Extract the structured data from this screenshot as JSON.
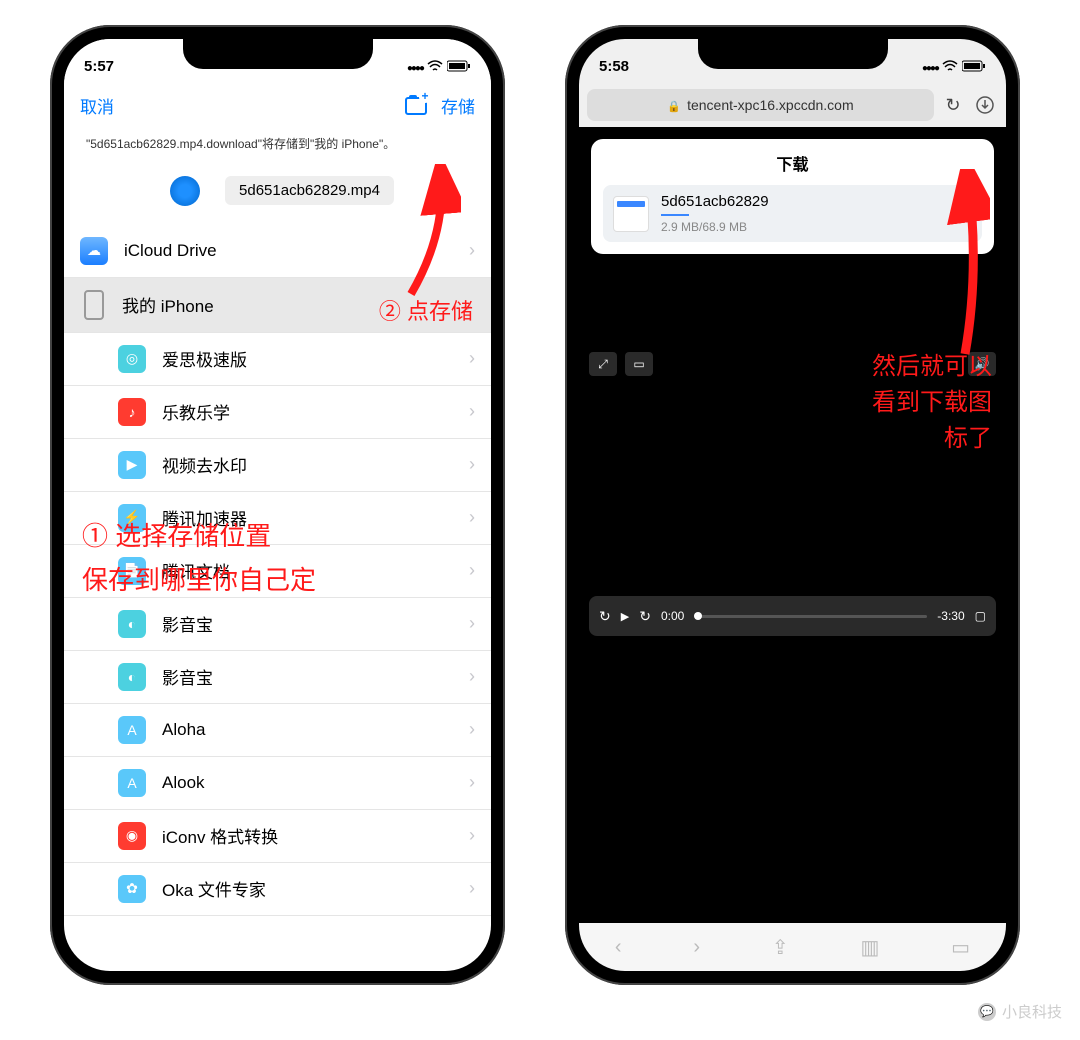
{
  "left": {
    "time": "5:57",
    "nav": {
      "cancel": "取消",
      "save": "存储"
    },
    "subtext": "\"5d651acb62829.mp4.download\"将存储到\"我的 iPhone\"。",
    "filename": "5d651acb62829.mp4",
    "locations": {
      "icloud": "iCloud Drive",
      "myiphone": "我的 iPhone"
    },
    "folders": [
      "爱思极速版",
      "乐教乐学",
      "视频去水印",
      "腾讯加速器",
      "腾讯文档",
      "影音宝",
      "影音宝",
      "Aloha",
      "Alook",
      "iConv 格式转换",
      "Oka 文件专家"
    ],
    "anno_step2": "② 点存储",
    "anno_step1_line1": "① 选择存储位置",
    "anno_step1_line2": "保存到哪里你自己定"
  },
  "right": {
    "time": "5:58",
    "url": "tencent-xpc16.xpccdn.com",
    "download": {
      "title": "下载",
      "name": "5d651acb62829",
      "size": "2.9 MB/68.9 MB"
    },
    "video": {
      "current": "0:00",
      "remaining": "-3:30"
    },
    "anno_line1": "然后就可以",
    "anno_line2": "看到下载图",
    "anno_line3": "标了"
  },
  "watermark": "小良科技"
}
